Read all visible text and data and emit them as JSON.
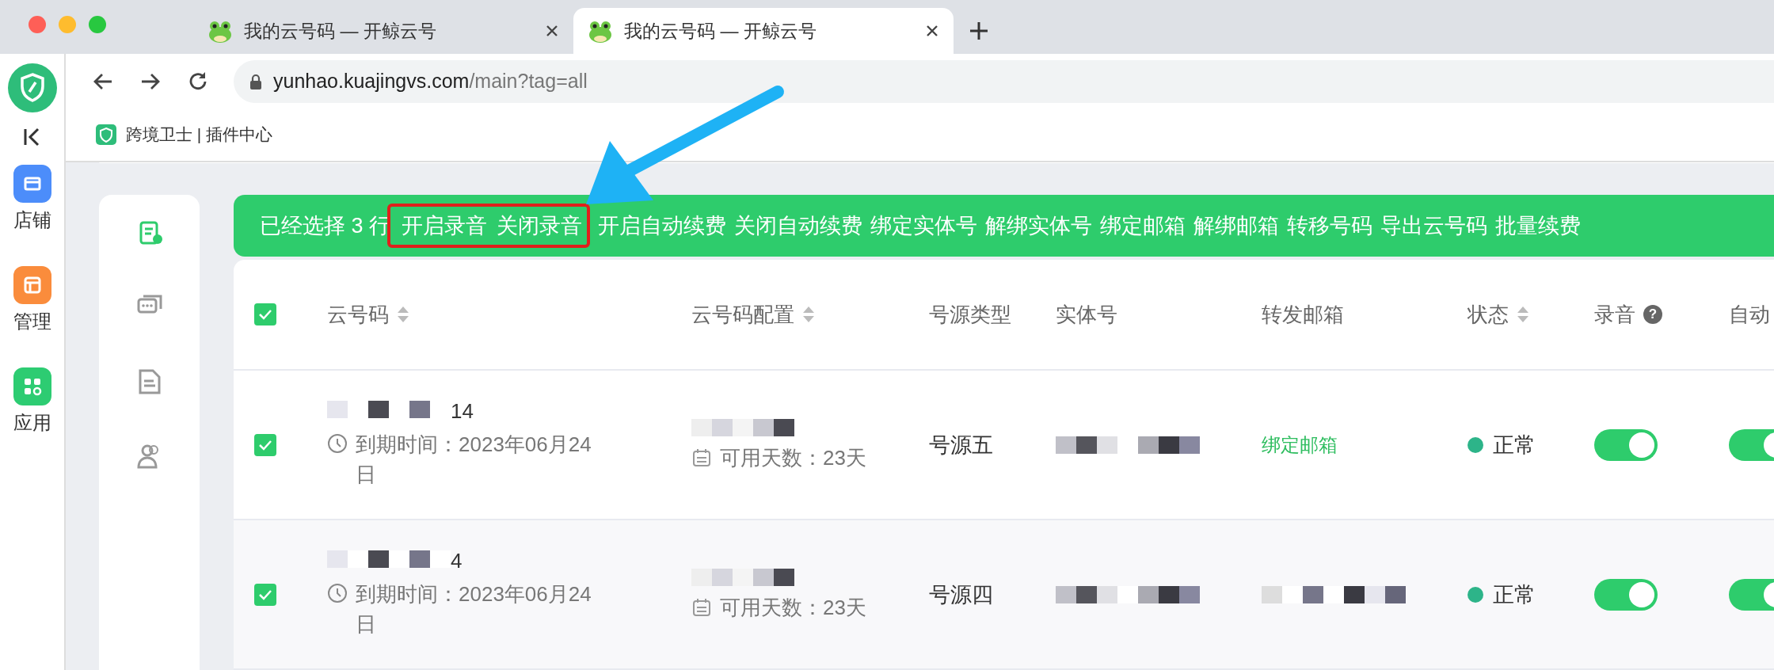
{
  "tabs": [
    {
      "title": "我的云号码 — 开鲸云号",
      "selected": false
    },
    {
      "title": "我的云号码 — 开鲸云号",
      "selected": true
    }
  ],
  "address": {
    "host": "yunhao.kuajingvs.com",
    "path": "/main?tag=all"
  },
  "bookmarks": [
    {
      "label": "跨境卫士 | 插件中心"
    }
  ],
  "app_sidebar": [
    {
      "kind": "store",
      "label": "店铺",
      "color": "#4c8dfa"
    },
    {
      "kind": "panel",
      "label": "管理",
      "color": "#fa8c3c"
    },
    {
      "kind": "apps",
      "label": "应用",
      "color": "#2dcc72"
    }
  ],
  "side_nav": [
    {
      "kind": "phone",
      "selected": true
    },
    {
      "kind": "chat",
      "selected": false
    },
    {
      "kind": "doc",
      "selected": false
    },
    {
      "kind": "users",
      "selected": false
    }
  ],
  "selection_bar": {
    "text": "已经选择 3 行",
    "actions": [
      {
        "label": "开启录音",
        "highlighted": true
      },
      {
        "label": "关闭录音",
        "highlighted": true
      },
      {
        "label": "开启自动续费",
        "highlighted": false
      },
      {
        "label": "关闭自动续费",
        "highlighted": false
      },
      {
        "label": "绑定实体号",
        "highlighted": false
      },
      {
        "label": "解绑实体号",
        "highlighted": false
      },
      {
        "label": "绑定邮箱",
        "highlighted": false
      },
      {
        "label": "解绑邮箱",
        "highlighted": false
      },
      {
        "label": "转移号码",
        "highlighted": false
      },
      {
        "label": "导出云号码",
        "highlighted": false
      },
      {
        "label": "批量续费",
        "highlighted": false
      }
    ]
  },
  "table": {
    "all_checked": true,
    "columns": [
      {
        "label": "云号码",
        "sortable": true
      },
      {
        "label": "云号码配置",
        "sortable": true
      },
      {
        "label": "号源类型",
        "sortable": false
      },
      {
        "label": "实体号",
        "sortable": false
      },
      {
        "label": "转发邮箱",
        "sortable": false
      },
      {
        "label": "状态",
        "sortable": true
      },
      {
        "label": "录音",
        "sortable": false,
        "help": "?"
      },
      {
        "label": "自动"
      }
    ],
    "rows": [
      {
        "checked": true,
        "number_tail": "14",
        "expiry": "到期时间：2023年06月24日",
        "days": "可用天数：23天",
        "source": "号源五",
        "email": {
          "kind": "link",
          "text": "绑定邮箱"
        },
        "status": "正常",
        "recording": true,
        "auto_renew": true
      },
      {
        "checked": true,
        "number_tail": "4",
        "expiry": "到期时间：2023年06月24日",
        "days": "可用天数：23天",
        "source": "号源四",
        "email": {
          "kind": "redacted"
        },
        "status": "正常",
        "recording": true,
        "auto_renew": true
      }
    ]
  }
}
